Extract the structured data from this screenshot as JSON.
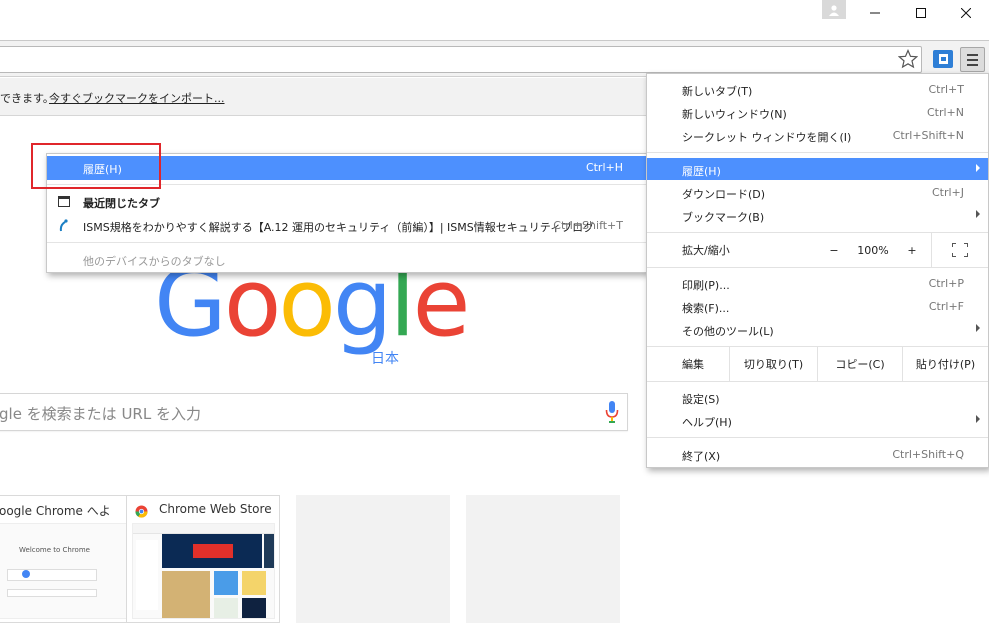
{
  "window": {
    "profile_icon": "person-icon",
    "minimize_icon": "minimize-icon",
    "maximize_icon": "maximize-icon",
    "close_icon": "close-icon"
  },
  "bookmark_bar": {
    "text": "できます。",
    "link": "今すぐブックマークをインポート..."
  },
  "logo": {
    "letters": [
      "G",
      "o",
      "o",
      "g",
      "l",
      "e"
    ],
    "colors": [
      "#4285f4",
      "#ea4335",
      "#fbbc05",
      "#4285f4",
      "#34a853",
      "#ea4335"
    ],
    "region": "日本"
  },
  "search": {
    "placeholder": "gle を検索または URL を入力"
  },
  "tiles": [
    {
      "title": "oogle Chrome へよ",
      "thumb_text": "Welcome to Chrome"
    },
    {
      "title": "Chrome Web Store"
    },
    {
      "title": ""
    },
    {
      "title": ""
    }
  ],
  "history_submenu": {
    "header": {
      "label": "履歴(H)",
      "shortcut": "Ctrl+H"
    },
    "recently_closed": "最近閉じたタブ",
    "entry": {
      "label": "ISMS規格をわかりやすく解説する【A.12 運用のセキュリティ（前編）】| ISMS情報セキュリティブログ",
      "shortcut": "Ctrl+Shift+T"
    },
    "no_other_devices": "他のデバイスからのタブなし"
  },
  "main_menu": {
    "new_tab": {
      "label": "新しいタブ(T)",
      "shortcut": "Ctrl+T"
    },
    "new_window": {
      "label": "新しいウィンドウ(N)",
      "shortcut": "Ctrl+N"
    },
    "incognito": {
      "label": "シークレット ウィンドウを開く(I)",
      "shortcut": "Ctrl+Shift+N"
    },
    "history": {
      "label": "履歴(H)"
    },
    "downloads": {
      "label": "ダウンロード(D)",
      "shortcut": "Ctrl+J"
    },
    "bookmarks": {
      "label": "ブックマーク(B)"
    },
    "zoom": {
      "label": "拡大/縮小",
      "minus": "−",
      "value": "100%",
      "plus": "+"
    },
    "print": {
      "label": "印刷(P)...",
      "shortcut": "Ctrl+P"
    },
    "find": {
      "label": "検索(F)...",
      "shortcut": "Ctrl+F"
    },
    "more_tools": {
      "label": "その他のツール(L)"
    },
    "edit": {
      "label": "編集",
      "cut": "切り取り(T)",
      "copy": "コピー(C)",
      "paste": "貼り付け(P)"
    },
    "settings": {
      "label": "設定(S)"
    },
    "help": {
      "label": "ヘルプ(H)"
    },
    "exit": {
      "label": "終了(X)",
      "shortcut": "Ctrl+Shift+Q"
    }
  },
  "colors": {
    "highlight": "#4d90fe",
    "annotation_box": "#e0262b"
  }
}
